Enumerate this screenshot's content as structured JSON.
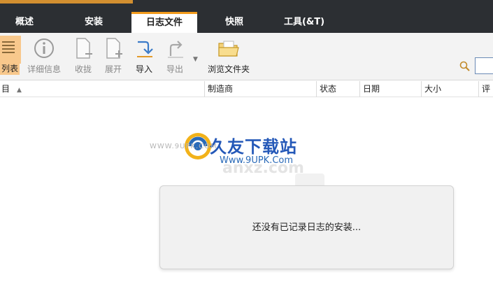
{
  "tabs": [
    {
      "label": "概述",
      "active": false
    },
    {
      "label": "安装",
      "active": false
    },
    {
      "label": "日志文件",
      "active": true
    },
    {
      "label": "快照",
      "active": false
    },
    {
      "label": "工具(&T)",
      "active": false
    }
  ],
  "toolbar": {
    "list_label": "列表",
    "details_label": "详细信息",
    "collapse_label": "收拢",
    "expand_label": "展开",
    "import_label": "导入",
    "export_label": "导出",
    "browse_label": "浏览文件夹"
  },
  "search": {
    "value": ""
  },
  "columns": [
    "目",
    "制造商",
    "状态",
    "日期",
    "大小",
    "评"
  ],
  "watermark": {
    "brand_cn": "久友下载站",
    "brand_url": "Www.9UPK.Com",
    "site": "WWW.9UPK.COM",
    "faint": "anxz.com"
  },
  "empty_state": {
    "message": "还没有已记录日志的安装..."
  },
  "colors": {
    "tabbar_bg": "#2c2f33",
    "active_accent": "#f29b1c",
    "toolbar_bg": "#f3f3f3",
    "panel_bg": "#f1f1f1"
  }
}
